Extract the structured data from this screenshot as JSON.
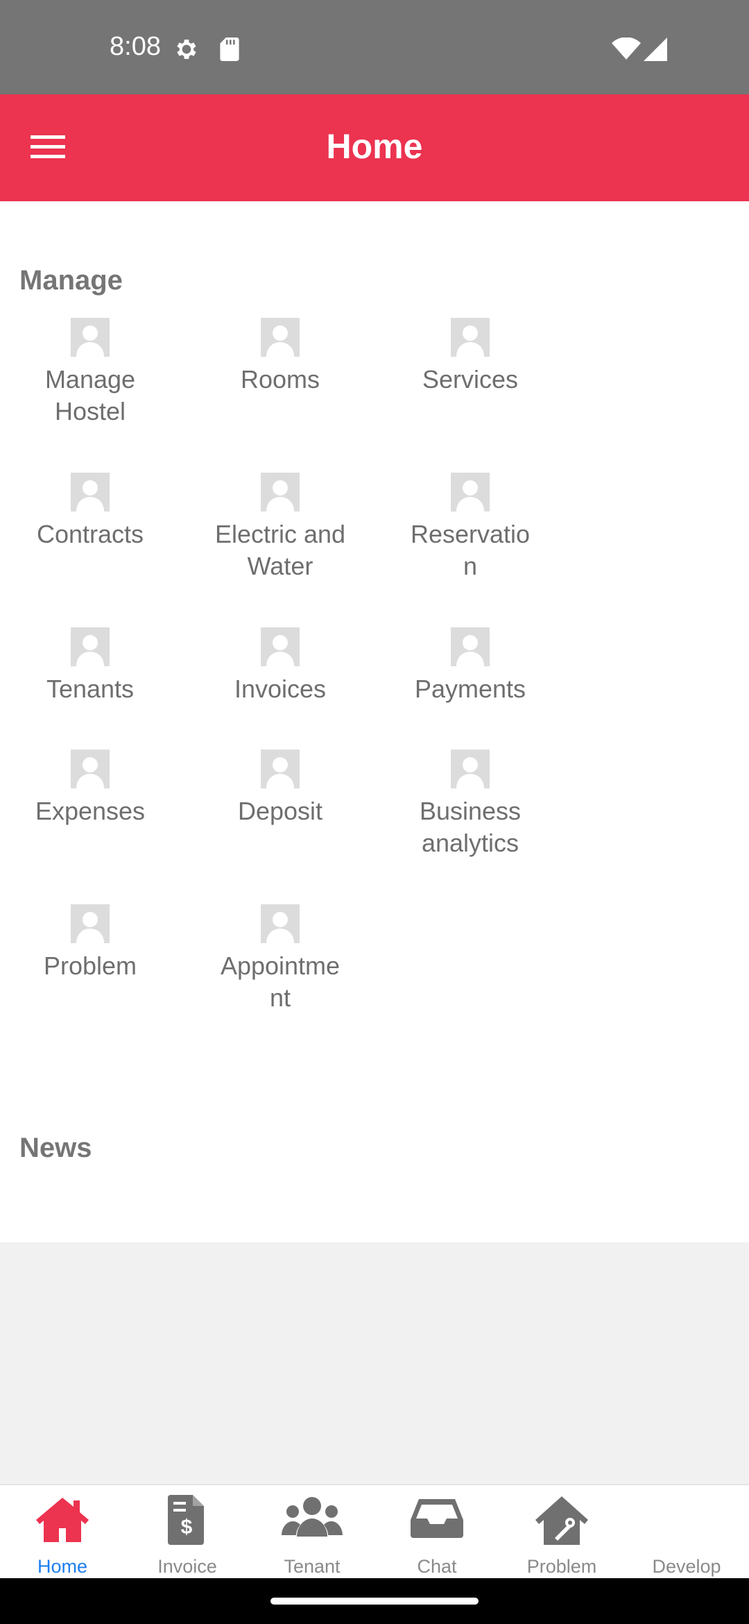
{
  "status_bar": {
    "time": "8:08",
    "icons": [
      "settings-gear-icon",
      "sd-card-icon",
      "wifi-icon",
      "cell-signal-icon"
    ]
  },
  "app_bar": {
    "title": "Home",
    "menu_icon": "hamburger-menu-icon",
    "background_color": "#ec3350"
  },
  "manage": {
    "title": "Manage",
    "items": [
      {
        "label": "Manage\nHostel",
        "icon": "avatar-placeholder-icon"
      },
      {
        "label": "Rooms",
        "icon": "avatar-placeholder-icon"
      },
      {
        "label": "Services",
        "icon": "avatar-placeholder-icon"
      },
      {
        "label": "Contracts",
        "icon": "avatar-placeholder-icon"
      },
      {
        "label": "Electric and\nWater",
        "icon": "avatar-placeholder-icon"
      },
      {
        "label": "Reservatio\nn",
        "icon": "avatar-placeholder-icon"
      },
      {
        "label": "Tenants",
        "icon": "avatar-placeholder-icon"
      },
      {
        "label": "Invoices",
        "icon": "avatar-placeholder-icon"
      },
      {
        "label": "Payments",
        "icon": "avatar-placeholder-icon"
      },
      {
        "label": "Expenses",
        "icon": "avatar-placeholder-icon"
      },
      {
        "label": "Deposit",
        "icon": "avatar-placeholder-icon"
      },
      {
        "label": "Business\nanalytics",
        "icon": "avatar-placeholder-icon"
      },
      {
        "label": "Problem",
        "icon": "avatar-placeholder-icon"
      },
      {
        "label": "Appointme\nnt",
        "icon": "avatar-placeholder-icon"
      }
    ]
  },
  "news": {
    "title": "News"
  },
  "bottom_nav": {
    "active_color": "#ec3350",
    "active_label_color": "#1d7ef0",
    "items": [
      {
        "label": "Home",
        "icon": "home-icon",
        "active": true
      },
      {
        "label": "Invoice",
        "icon": "invoice-icon",
        "active": false
      },
      {
        "label": "Tenant",
        "icon": "users-icon",
        "active": false
      },
      {
        "label": "Chat",
        "icon": "inbox-icon",
        "active": false
      },
      {
        "label": "Problem",
        "icon": "house-repair-icon",
        "active": false
      },
      {
        "label": "Develop",
        "icon": "develop-icon",
        "active": false
      }
    ]
  }
}
